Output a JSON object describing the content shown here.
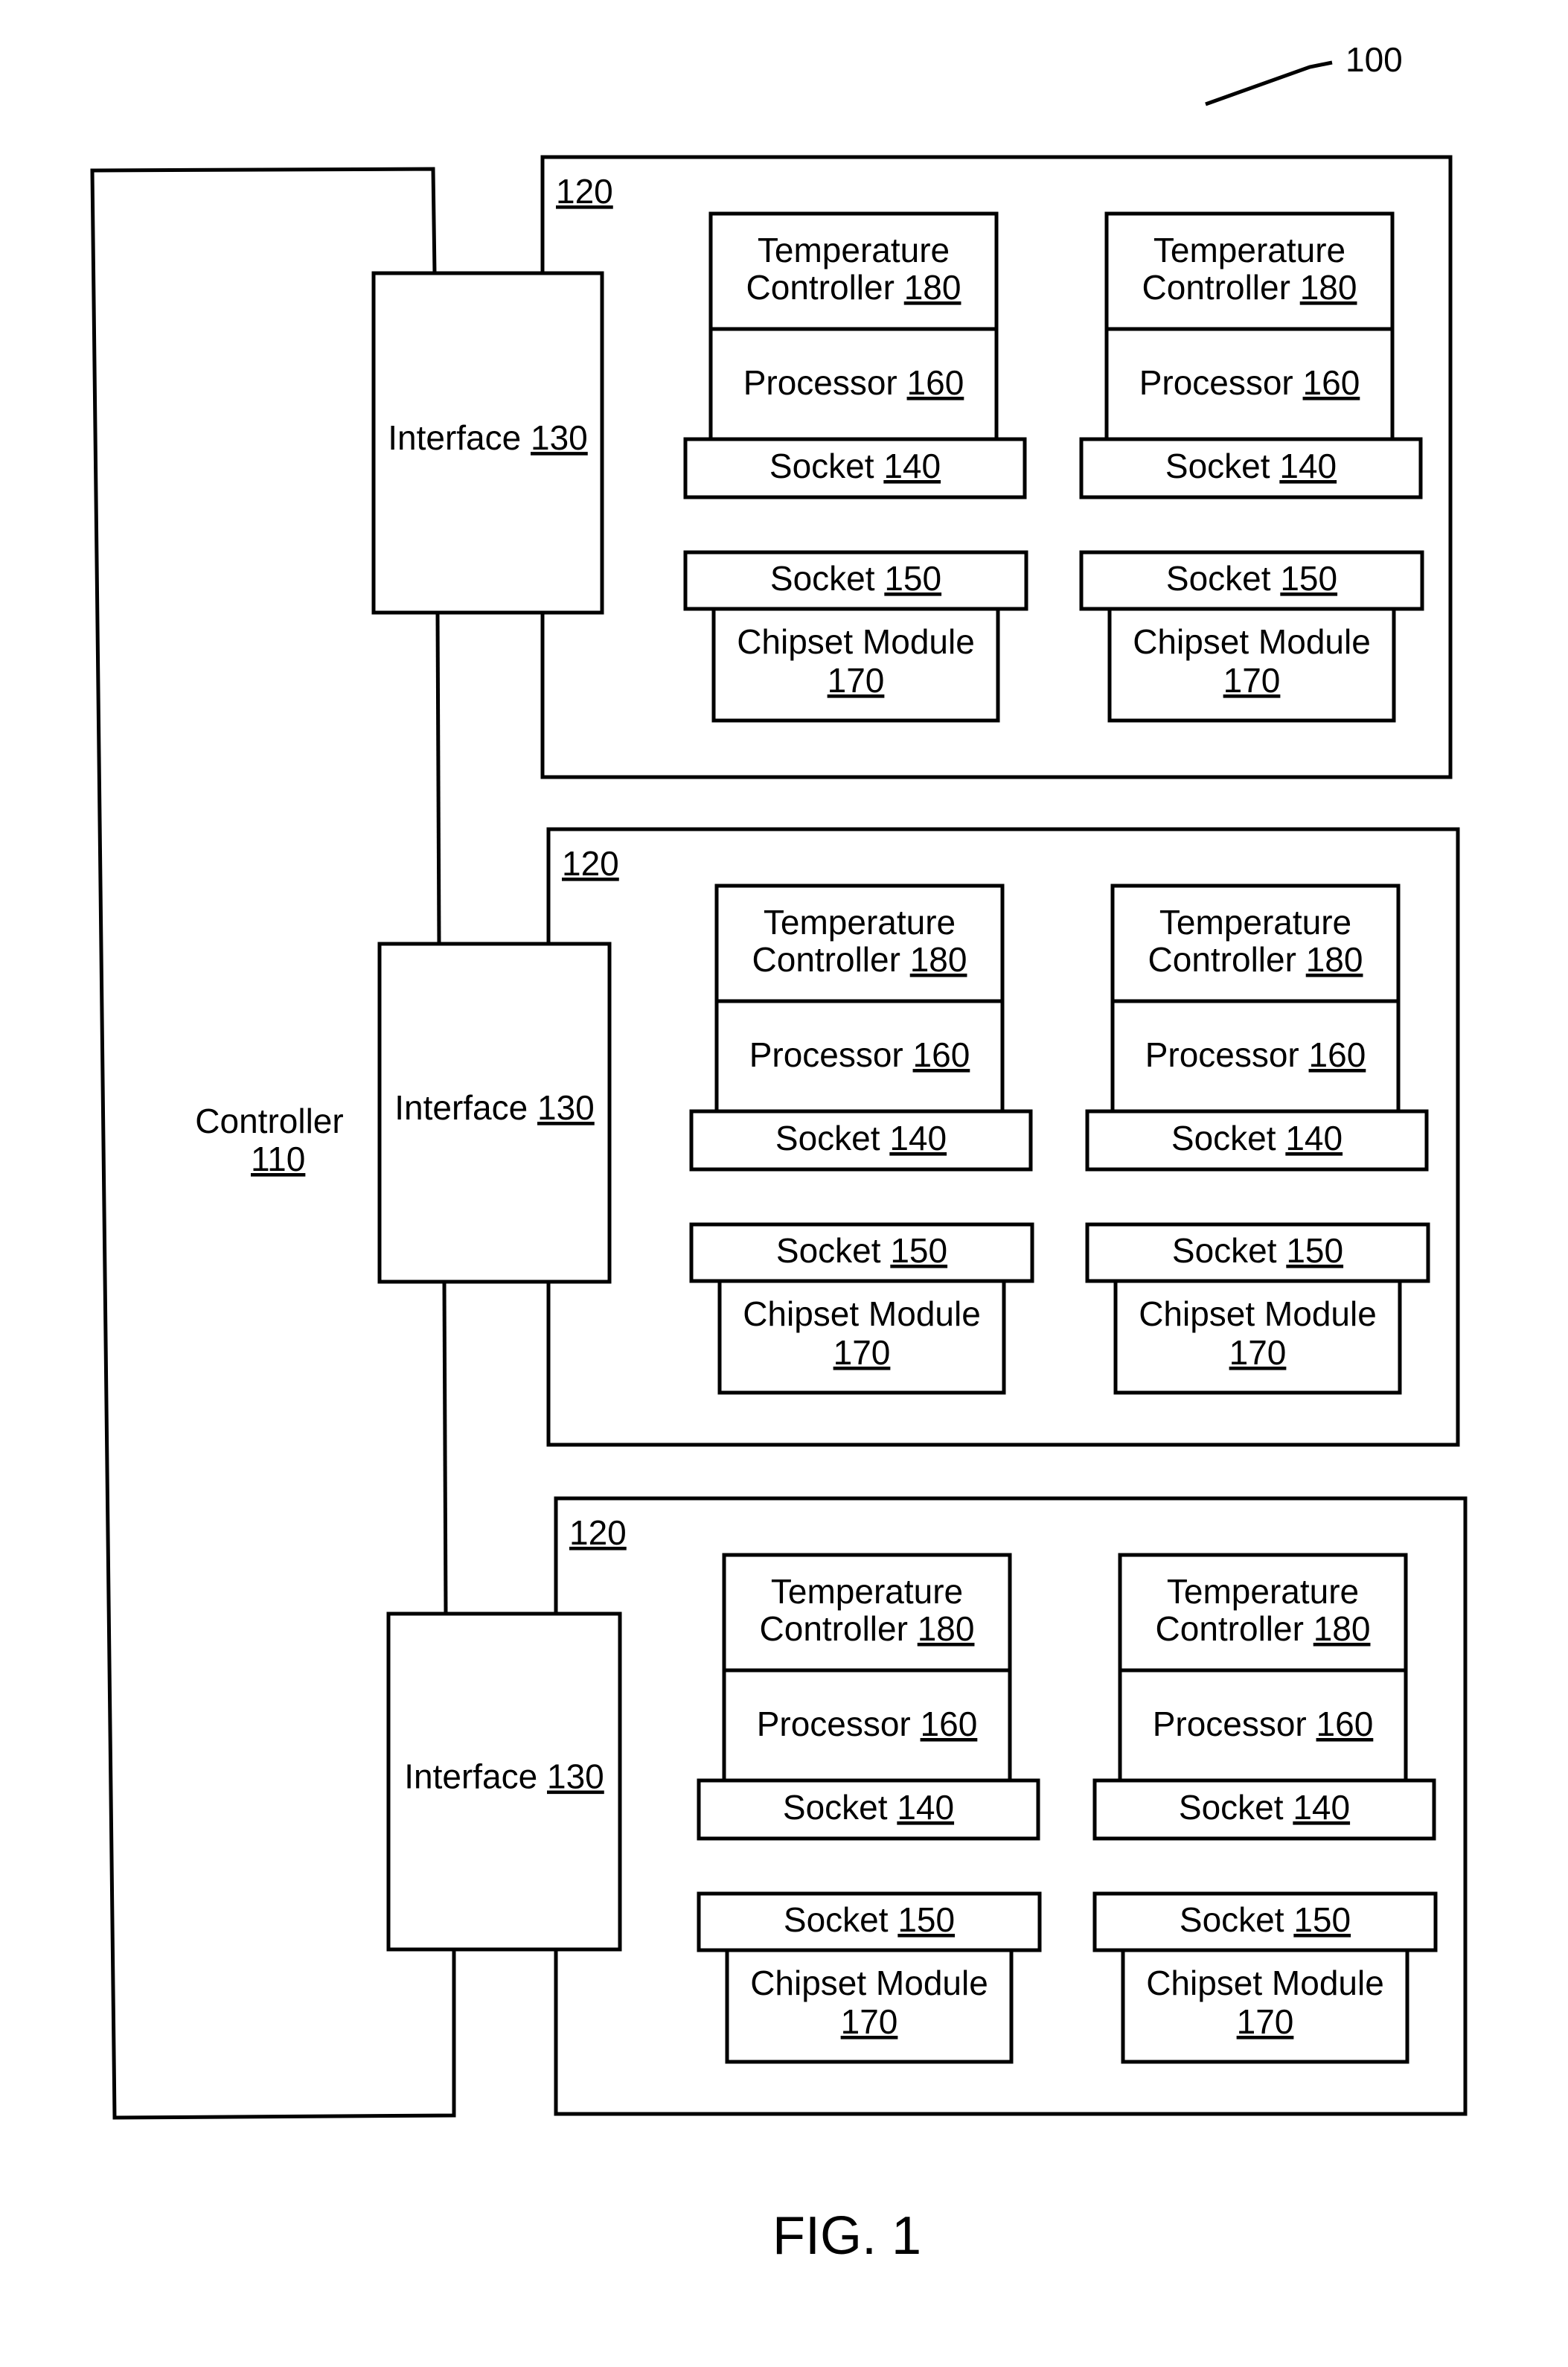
{
  "figure": {
    "caption": "FIG. 1",
    "system_ref": "100"
  },
  "controller": {
    "label": "Controller",
    "ref": "110"
  },
  "boards": [
    {
      "ref": "120",
      "interface": {
        "label": "Interface",
        "ref": "130"
      },
      "modules": [
        {
          "temp_label_1": "Temperature",
          "temp_label_2": "Controller",
          "temp_ref": "180",
          "proc_label": "Processor",
          "proc_ref": "160",
          "socket1_label": "Socket",
          "socket1_ref": "140",
          "socket2_label": "Socket",
          "socket2_ref": "150",
          "chipset_label": "Chipset Module",
          "chipset_ref": "170"
        },
        {
          "temp_label_1": "Temperature",
          "temp_label_2": "Controller",
          "temp_ref": "180",
          "proc_label": "Processor",
          "proc_ref": "160",
          "socket1_label": "Socket",
          "socket1_ref": "140",
          "socket2_label": "Socket",
          "socket2_ref": "150",
          "chipset_label": "Chipset Module",
          "chipset_ref": "170"
        }
      ]
    },
    {
      "ref": "120",
      "interface": {
        "label": "Interface",
        "ref": "130"
      },
      "modules": [
        {
          "temp_label_1": "Temperature",
          "temp_label_2": "Controller",
          "temp_ref": "180",
          "proc_label": "Processor",
          "proc_ref": "160",
          "socket1_label": "Socket",
          "socket1_ref": "140",
          "socket2_label": "Socket",
          "socket2_ref": "150",
          "chipset_label": "Chipset Module",
          "chipset_ref": "170"
        },
        {
          "temp_label_1": "Temperature",
          "temp_label_2": "Controller",
          "temp_ref": "180",
          "proc_label": "Processor",
          "proc_ref": "160",
          "socket1_label": "Socket",
          "socket1_ref": "140",
          "socket2_label": "Socket",
          "socket2_ref": "150",
          "chipset_label": "Chipset Module",
          "chipset_ref": "170"
        }
      ]
    },
    {
      "ref": "120",
      "interface": {
        "label": "Interface",
        "ref": "130"
      },
      "modules": [
        {
          "temp_label_1": "Temperature",
          "temp_label_2": "Controller",
          "temp_ref": "180",
          "proc_label": "Processor",
          "proc_ref": "160",
          "socket1_label": "Socket",
          "socket1_ref": "140",
          "socket2_label": "Socket",
          "socket2_ref": "150",
          "chipset_label": "Chipset Module",
          "chipset_ref": "170"
        },
        {
          "temp_label_1": "Temperature",
          "temp_label_2": "Controller",
          "temp_ref": "180",
          "proc_label": "Processor",
          "proc_ref": "160",
          "socket1_label": "Socket",
          "socket1_ref": "140",
          "socket2_label": "Socket",
          "socket2_ref": "150",
          "chipset_label": "Chipset Module",
          "chipset_ref": "170"
        }
      ]
    }
  ]
}
